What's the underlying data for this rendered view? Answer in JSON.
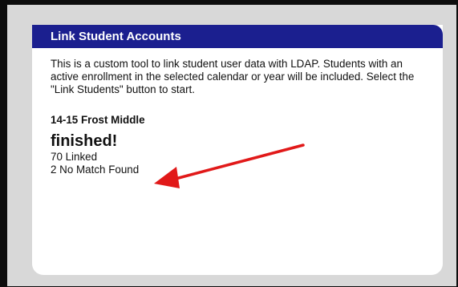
{
  "panel": {
    "title": "Link Student Accounts",
    "description": "This is a custom tool to link student user data with LDAP. Students with an active enrollment in the selected calendar or year will be included. Select the \"Link Students\" button to start.",
    "calendar_name": "14-15 Frost Middle",
    "status": "finished!",
    "results": [
      "70 Linked",
      "2 No Match Found"
    ]
  },
  "colors": {
    "header_background": "#1b1f8f",
    "header_text": "#ffffff",
    "frame_background": "#d8d8d8",
    "annotation_arrow": "#e11919"
  }
}
